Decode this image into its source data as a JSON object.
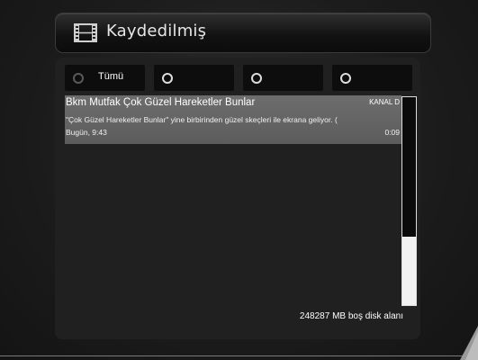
{
  "header": {
    "title": "Kaydedilmiş",
    "icon": "film-icon"
  },
  "tabs": [
    {
      "label": "Tümü",
      "selected": true
    },
    {
      "label": "",
      "selected": false
    },
    {
      "label": "",
      "selected": false
    },
    {
      "label": "",
      "selected": false
    }
  ],
  "recordings": [
    {
      "title": "Bkm Mutfak Çok Güzel Hareketler Bunlar",
      "channel": "KANAL D",
      "description": "\"Çok Güzel Hareketler Bunlar\" yine birbirinden güzel skeçleri ile ekrana geliyor. (",
      "time": "Bugün, 9:43",
      "duration": "0:09"
    }
  ],
  "disk": {
    "free_text": "248287 MB boş disk alanı",
    "free_fraction": 0.33
  },
  "colors": {
    "selected_row": "#636363",
    "tab_bg": "#0d0d0d",
    "panel_bg": "#202020"
  }
}
